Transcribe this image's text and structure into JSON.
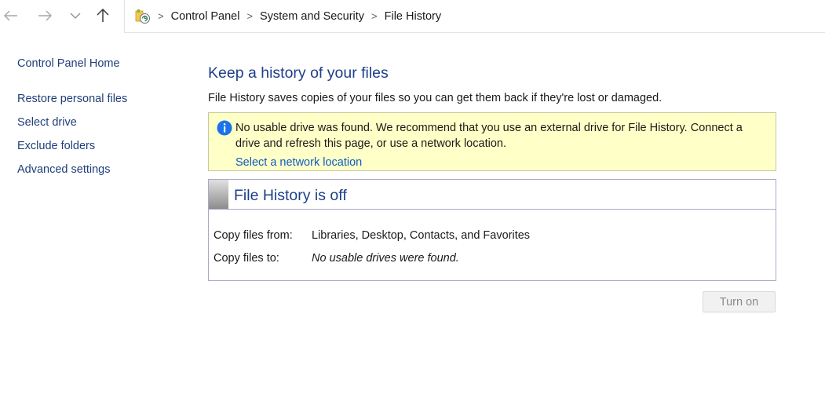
{
  "nav": {
    "back_icon": "arrow-left-icon",
    "forward_icon": "arrow-right-icon",
    "recent_icon": "chevron-down-icon",
    "up_icon": "arrow-up-icon"
  },
  "breadcrumb": {
    "items": [
      "Control Panel",
      "System and Security",
      "File History"
    ],
    "separator": ">"
  },
  "sidebar": {
    "home": "Control Panel Home",
    "tasks": [
      "Restore personal files",
      "Select drive",
      "Exclude folders",
      "Advanced settings"
    ]
  },
  "main": {
    "title": "Keep a history of your files",
    "description": "File History saves copies of your files so you can get them back if they're lost or damaged.",
    "warning": {
      "text": "No usable drive was found. We recommend that you use an external drive for File History. Connect a drive and refresh this page, or use a network location.",
      "link": "Select a network location"
    },
    "status": {
      "title": "File History is off",
      "copy_from_label": "Copy files from:",
      "copy_from_value": "Libraries, Desktop, Contacts, and Favorites",
      "copy_to_label": "Copy files to:",
      "copy_to_value": "No usable drives were found."
    },
    "turn_on": "Turn on"
  },
  "colors": {
    "link": "#1f3f79",
    "heading": "#1e3f8a",
    "warning_bg": "#ffffc8",
    "info_blue": "#1a73e8"
  }
}
